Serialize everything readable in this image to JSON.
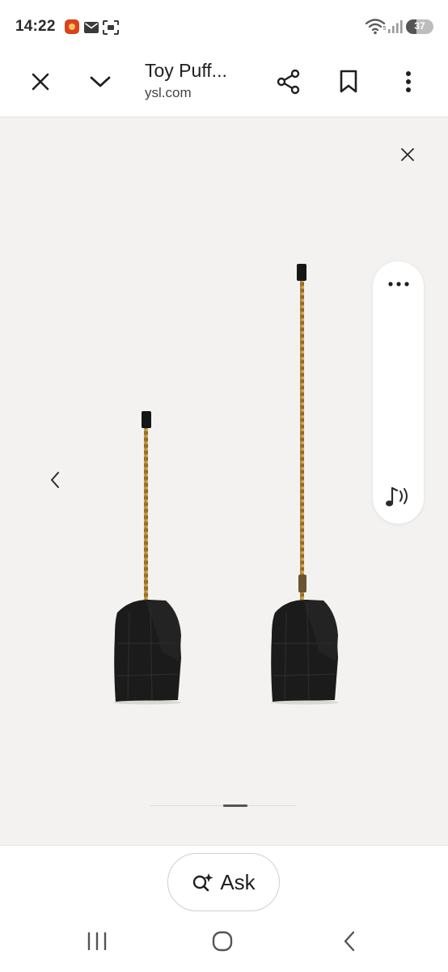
{
  "status_bar": {
    "time": "14:22",
    "battery_level": "37",
    "battery_fraction": 0.37,
    "icons": [
      "app-notification-icon",
      "mail-icon",
      "screenshot-icon",
      "wifi-icon",
      "signal-icon",
      "battery-icon"
    ]
  },
  "top_bar": {
    "title": "Toy Puff...",
    "domain": "ysl.com",
    "icons": [
      "close-icon",
      "chevron-down-icon",
      "share-icon",
      "bookmark-icon",
      "more-vert-icon"
    ]
  },
  "viewer": {
    "icons": [
      "close-icon",
      "chevron-left-icon",
      "more-horiz-icon",
      "music-note-icon"
    ],
    "image": "two black quilted shoulder bags with gold chain straps",
    "page_count": 6,
    "active_page_index": 3
  },
  "bottom": {
    "ask_label": "Ask",
    "icons": [
      "search-sparkle-icon"
    ]
  },
  "nav_bar": {
    "icons": [
      "recents-icon",
      "home-icon",
      "back-icon"
    ]
  },
  "colors": {
    "viewer_background": "#f3f2f0",
    "bag": "#1b1b1b",
    "chain": "#b38a3c"
  }
}
